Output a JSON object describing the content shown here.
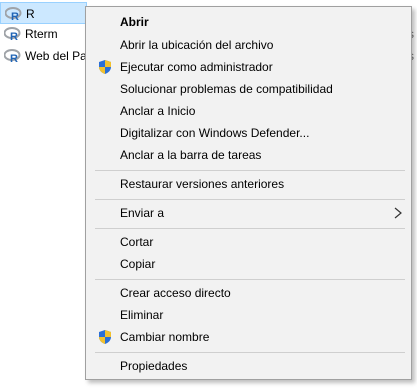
{
  "files": [
    {
      "name": "R",
      "icon": "r-logo-icon",
      "selected": true
    },
    {
      "name": "Rterm",
      "icon": "r-logo-icon",
      "selected": false
    },
    {
      "name": "Web del Pa",
      "icon": "r-logo-icon",
      "selected": false
    }
  ],
  "files_trailing_fragment": "s",
  "context_menu": {
    "items": [
      {
        "label": "Abrir",
        "bold": true
      },
      {
        "label": "Abrir la ubicación del archivo"
      },
      {
        "label": "Ejecutar como administrador",
        "icon": "uac-shield-icon"
      },
      {
        "label": "Solucionar problemas de compatibilidad"
      },
      {
        "label": "Anclar a Inicio"
      },
      {
        "label": "Digitalizar con Windows Defender..."
      },
      {
        "label": "Anclar a la barra de tareas"
      },
      {
        "label": "Restaurar versiones anteriores"
      },
      {
        "label": "Enviar a",
        "submenu": true
      },
      {
        "label": "Cortar"
      },
      {
        "label": "Copiar"
      },
      {
        "label": "Crear acceso directo"
      },
      {
        "label": "Eliminar"
      },
      {
        "label": "Cambiar nombre",
        "icon": "uac-shield-icon"
      },
      {
        "label": "Propiedades"
      }
    ]
  },
  "colors": {
    "selection_bg": "#cce8ff",
    "menu_bg": "#f2f2f2",
    "r_logo_blue": "#2165b6",
    "r_logo_grey": "#9fa3a8"
  }
}
